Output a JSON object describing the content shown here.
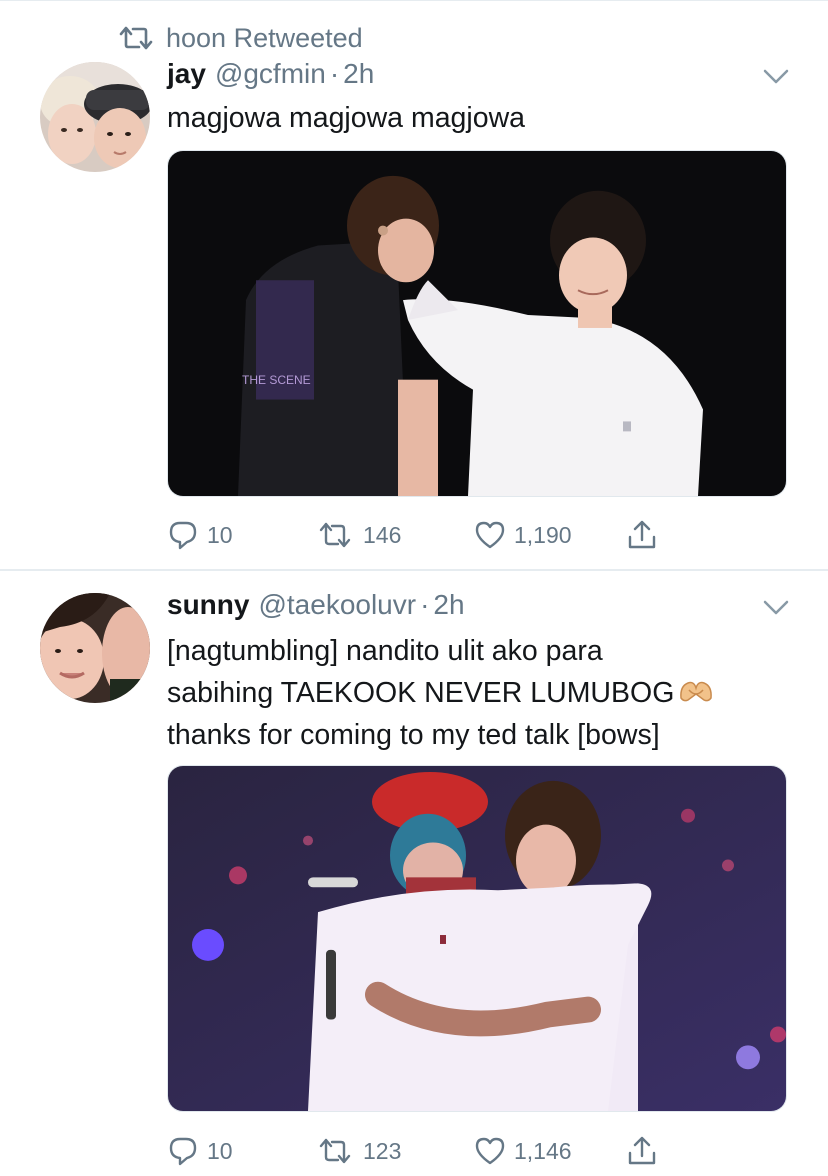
{
  "tweets": [
    {
      "retweet_label": "hoon Retweeted",
      "name": "jay",
      "handle": "@gcfmin",
      "dot": "·",
      "time": "2h",
      "lines": [
        "magjowa magjowa magjowa"
      ],
      "replies": "10",
      "retweets": "146",
      "likes": "1,190",
      "photo_text": "THE SCENE"
    },
    {
      "name": "sunny",
      "handle": "@taekooluvr",
      "dot": "·",
      "time": "2h",
      "lines": [
        "[nagtumbling] nandito ulit ako para",
        "sabihing TAEKOOK NEVER LUMUBOG",
        "thanks for coming to my ted talk [bows]"
      ],
      "emoji": "heart-hands-emoji",
      "replies": "10",
      "retweets": "123",
      "likes": "1,146"
    }
  ],
  "icons": {
    "retweeted": "retweet-icon",
    "caret": "chevron-down-icon",
    "reply": "reply-icon",
    "retweet": "retweet-icon",
    "like": "heart-icon",
    "share": "share-icon"
  },
  "colors": {
    "secondary_text": "#657786",
    "primary_text": "#14171a",
    "divider": "#e6ecf0"
  }
}
